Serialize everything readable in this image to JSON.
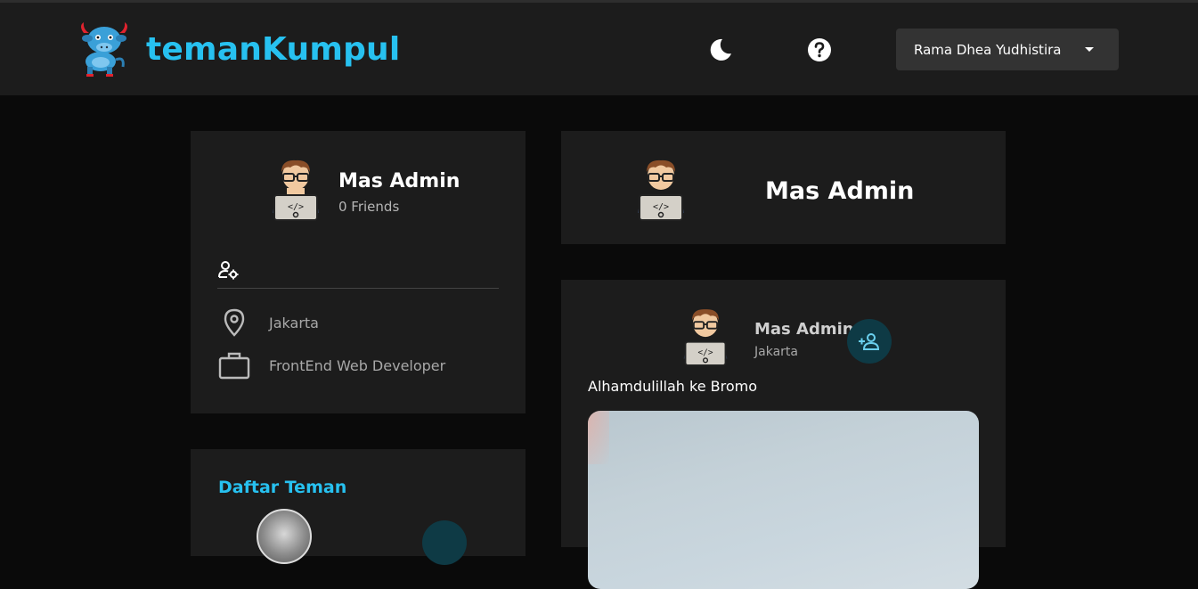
{
  "nav": {
    "brand": "temanKumpul",
    "user_name": "Rama Dhea Yudhistira",
    "icons": [
      "bull-mascot-logo",
      "moon-icon",
      "help-icon",
      "caret-down-icon"
    ]
  },
  "profile": {
    "name": "Mas Admin",
    "friends": "0 Friends",
    "location": "Jakarta",
    "job": "FrontEnd Web Developer",
    "icons": [
      "user-settings-icon",
      "location-pin-icon",
      "briefcase-icon"
    ]
  },
  "profile_header": {
    "name": "Mas Admin"
  },
  "post": {
    "author": "Mas Admin",
    "location": "Jakarta",
    "text": "Alhamdulillah ke Bromo",
    "icons": [
      "add-friend-icon"
    ]
  },
  "friends": {
    "title": "Daftar Teman"
  },
  "colors": {
    "accent": "#27c1f0",
    "background": "#0a0a0a",
    "card": "#1c1c1c",
    "navbar": "#1c1c1c",
    "button_dark_teal": "#0e3a45"
  }
}
